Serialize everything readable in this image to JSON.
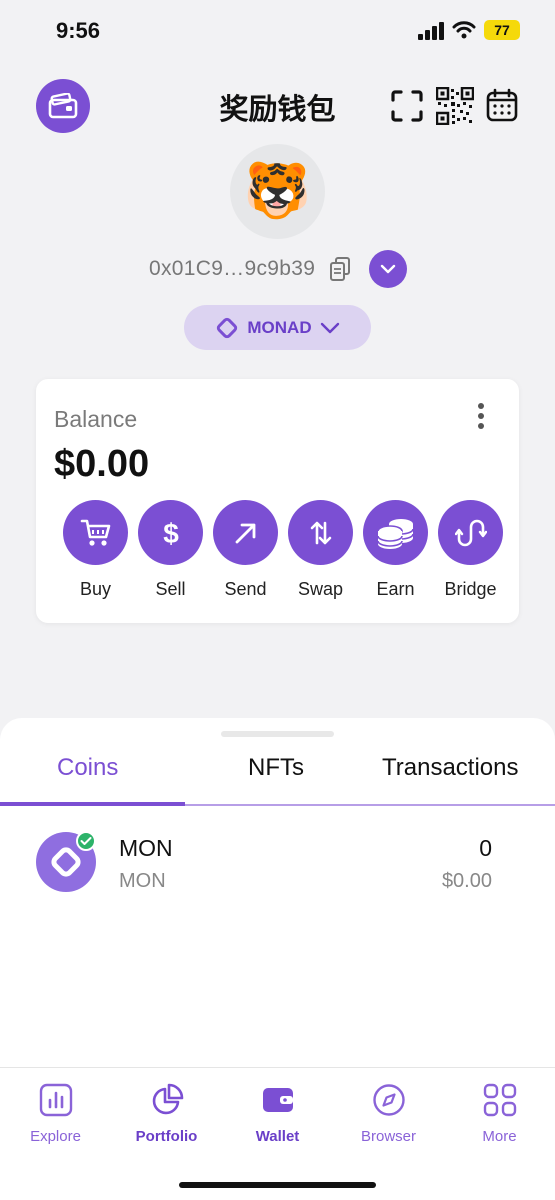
{
  "status_bar": {
    "time": "9:56",
    "battery": "77"
  },
  "header": {
    "title": "奖励钱包"
  },
  "account": {
    "avatar_emoji": "🐯",
    "address": "0x01C9…9c9b39",
    "network": "MONAD"
  },
  "balance": {
    "label": "Balance",
    "value": "$0.00",
    "actions": [
      {
        "label": "Buy",
        "icon": "cart-icon"
      },
      {
        "label": "Sell",
        "icon": "dollar-icon"
      },
      {
        "label": "Send",
        "icon": "arrow-up-right-icon"
      },
      {
        "label": "Swap",
        "icon": "swap-arrows-icon"
      },
      {
        "label": "Earn",
        "icon": "coins-stack-icon"
      },
      {
        "label": "Bridge",
        "icon": "bridge-icon"
      }
    ]
  },
  "tabs": [
    {
      "label": "Coins",
      "active": true
    },
    {
      "label": "NFTs",
      "active": false
    },
    {
      "label": "Transactions",
      "active": false
    }
  ],
  "coins": [
    {
      "name": "MON",
      "symbol": "MON",
      "amount": "0",
      "value": "$0.00",
      "verified": true
    }
  ],
  "nav": [
    {
      "label": "Explore",
      "icon": "bar-chart-icon"
    },
    {
      "label": "Portfolio",
      "icon": "pie-chart-icon"
    },
    {
      "label": "Wallet",
      "icon": "wallet-icon",
      "active": true
    },
    {
      "label": "Browser",
      "icon": "compass-icon"
    },
    {
      "label": "More",
      "icon": "grid-icon"
    }
  ],
  "colors": {
    "accent": "#7b4fd3",
    "accent_light": "#dcd3f1",
    "verified": "#2db36a",
    "battery": "#f5d90a"
  }
}
